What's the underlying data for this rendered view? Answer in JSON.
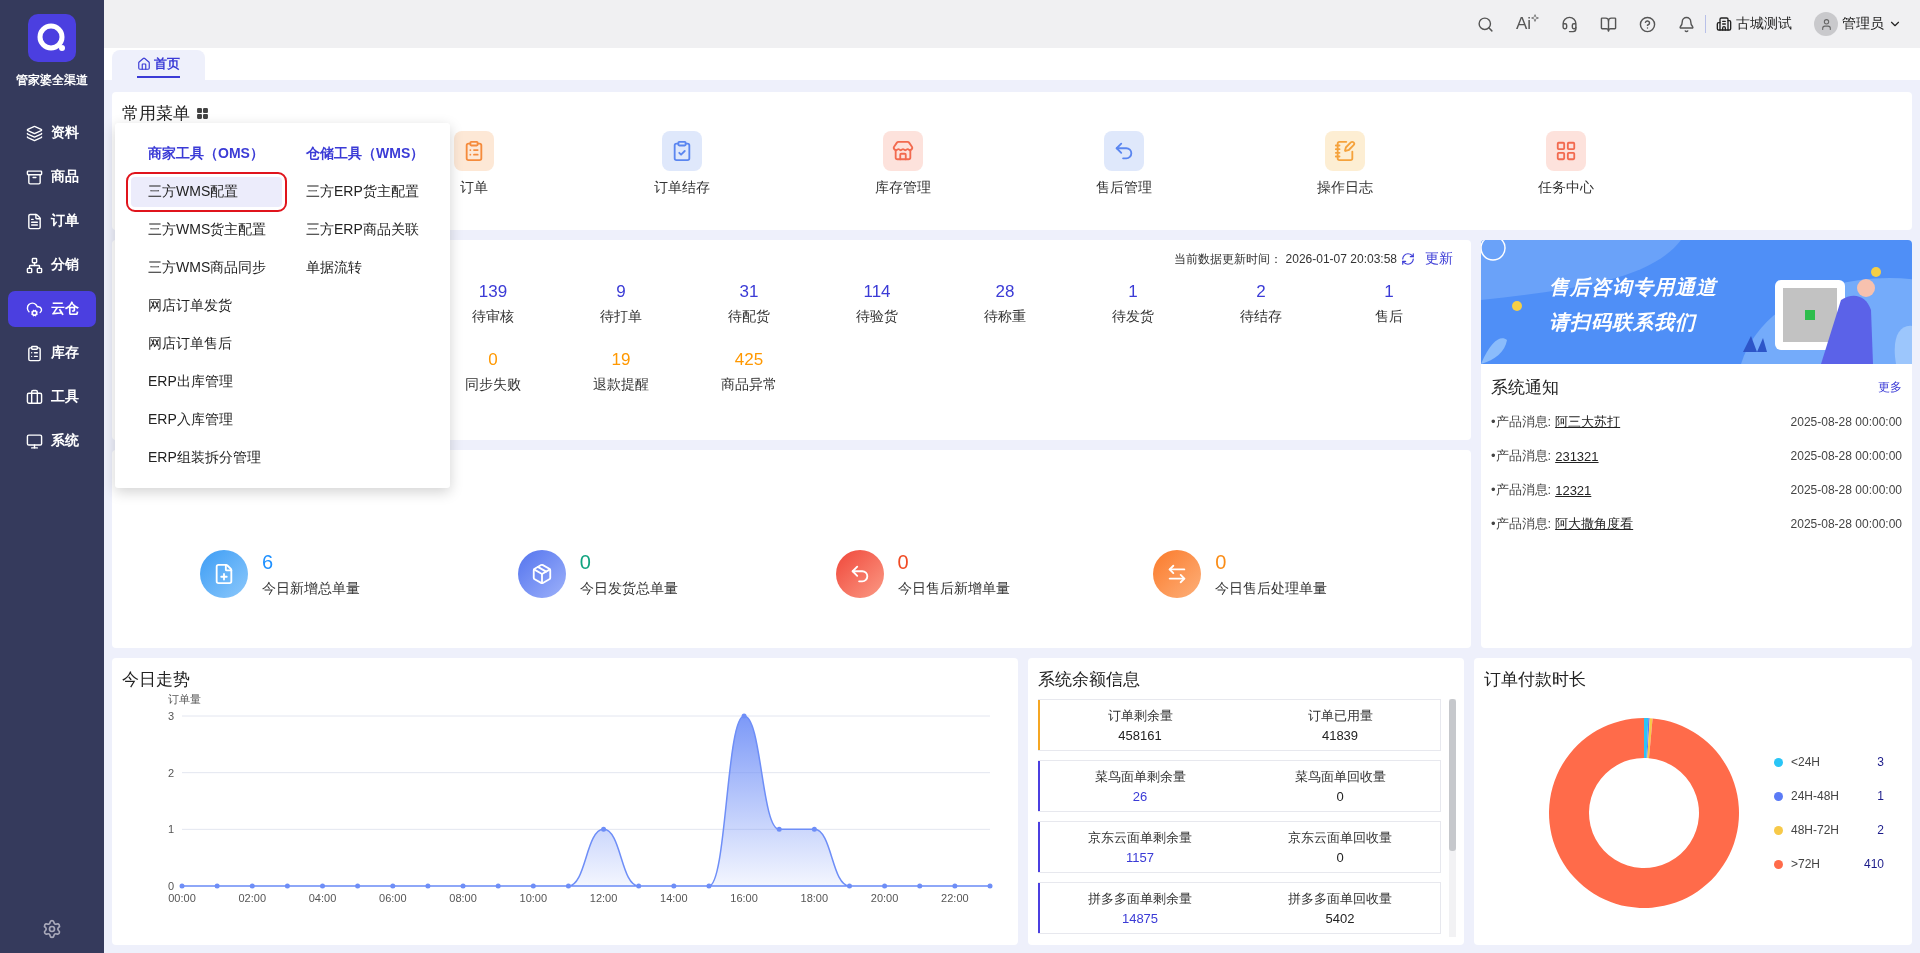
{
  "sidebar": {
    "brand": "管家婆全渠道",
    "items": [
      {
        "kind": "layers",
        "label": "资料",
        "selected": false
      },
      {
        "kind": "goods",
        "label": "商品",
        "selected": false
      },
      {
        "kind": "order",
        "label": "订单",
        "selected": false
      },
      {
        "kind": "network",
        "label": "分销",
        "selected": false
      },
      {
        "kind": "cloud",
        "label": "云仓",
        "selected": true
      },
      {
        "kind": "stock",
        "label": "库存",
        "selected": false
      },
      {
        "kind": "tools",
        "label": "工具",
        "selected": false
      },
      {
        "kind": "system",
        "label": "系统",
        "selected": false
      }
    ]
  },
  "header": {
    "ai": "Ai",
    "company": "古城测试",
    "user": "管理员"
  },
  "tabs": [
    {
      "label": "首页",
      "selected": true
    }
  ],
  "common_menu": {
    "title": "常用菜单",
    "items": [
      {
        "kind": "orange",
        "label": "订单"
      },
      {
        "kind": "blue",
        "label": "订单结存"
      },
      {
        "kind": "red",
        "label": "库存管理"
      },
      {
        "kind": "blue2",
        "label": "售后管理"
      },
      {
        "kind": "amber",
        "label": "操作日志"
      },
      {
        "kind": "grid",
        "label": "任务中心"
      }
    ]
  },
  "dropdown": {
    "columns": [
      {
        "title": "商家工具（OMS）",
        "items": [
          {
            "label": "三方WMS配置",
            "selected": true
          },
          {
            "label": "三方WMS货主配置",
            "selected": false
          },
          {
            "label": "三方WMS商品同步",
            "selected": false
          },
          {
            "label": "网店订单发货",
            "selected": false
          },
          {
            "label": "网店订单售后",
            "selected": false
          },
          {
            "label": "ERP出库管理",
            "selected": false
          },
          {
            "label": "ERP入库管理",
            "selected": false
          },
          {
            "label": "ERP组装拆分管理",
            "selected": false
          }
        ]
      },
      {
        "title": "仓储工具（WMS）",
        "items": [
          {
            "label": "三方ERP货主配置",
            "selected": false
          },
          {
            "label": "三方ERP商品关联",
            "selected": false
          },
          {
            "label": "单据流转",
            "selected": false
          }
        ]
      }
    ]
  },
  "stats": {
    "update_label": "当前数据更新时间：",
    "update_time": "2026-01-07 20:03:58",
    "refresh": "更新",
    "rows": [
      [
        {
          "value": "139",
          "label": "待审核"
        },
        {
          "value": "9",
          "label": "待打单"
        },
        {
          "value": "31",
          "label": "待配货"
        },
        {
          "value": "114",
          "label": "待验货"
        },
        {
          "value": "28",
          "label": "待称重"
        },
        {
          "value": "1",
          "label": "待发货"
        },
        {
          "value": "2",
          "label": "待结存"
        },
        {
          "value": "1",
          "label": "售后"
        }
      ],
      [
        {
          "value": "0",
          "label": "同步失败",
          "kind": "warn"
        },
        {
          "value": "19",
          "label": "退款提醒",
          "kind": "warn"
        },
        {
          "value": "425",
          "label": "商品异常",
          "kind": "warn"
        }
      ]
    ]
  },
  "today": [
    {
      "kind": "new",
      "value": "6",
      "label": "今日新增总单量",
      "color": "#1e90ff"
    },
    {
      "kind": "ship",
      "value": "0",
      "label": "今日发货总单量",
      "color": "#10a37f"
    },
    {
      "kind": "return",
      "value": "0",
      "label": "今日售后新增单量",
      "color": "#f04a23"
    },
    {
      "kind": "process",
      "value": "0",
      "label": "今日售后处理单量",
      "color": "#fa8c16"
    }
  ],
  "banner": {
    "lines": [
      "售后咨询专用通道",
      "请扫码联系我们"
    ]
  },
  "notices": {
    "title": "系统通知",
    "more": "更多",
    "items": [
      {
        "prefix": "•产品消息:",
        "link": "阿三大苏打",
        "time": "2025-08-28 00:00:00"
      },
      {
        "prefix": "•产品消息:",
        "link": "231321",
        "time": "2025-08-28 00:00:00"
      },
      {
        "prefix": "•产品消息:",
        "link": "12321",
        "time": "2025-08-28 00:00:00"
      },
      {
        "prefix": "•产品消息:",
        "link": "阿大撒角度看",
        "time": "2025-08-28 00:00:00"
      }
    ]
  },
  "trend": {
    "title": "今日走势",
    "chart_data": {
      "type": "area",
      "ylabel": "订单量",
      "x": [
        0,
        1,
        2,
        3,
        4,
        5,
        6,
        7,
        8,
        9,
        10,
        11,
        12,
        13,
        14,
        15,
        16,
        17,
        18,
        19,
        20,
        21,
        22,
        23
      ],
      "series": [
        {
          "color": "#6e8ef7",
          "values": [
            0,
            0,
            0,
            0,
            0,
            0,
            0,
            0,
            0,
            0,
            0,
            0,
            1,
            0,
            0,
            0,
            3,
            1,
            1,
            0,
            0,
            0,
            0,
            0
          ]
        }
      ],
      "xlim": [
        0,
        23
      ],
      "ylim": [
        0,
        3
      ],
      "yticks": [
        0,
        1,
        2,
        3
      ],
      "xticks": [
        {
          "value": 0,
          "label": "00:00"
        },
        {
          "value": 2,
          "label": "02:00"
        },
        {
          "value": 4,
          "label": "04:00"
        },
        {
          "value": 6,
          "label": "06:00"
        },
        {
          "value": 8,
          "label": "08:00"
        },
        {
          "value": 10,
          "label": "10:00"
        },
        {
          "value": 12,
          "label": "12:00"
        },
        {
          "value": 14,
          "label": "14:00"
        },
        {
          "value": 16,
          "label": "16:00"
        },
        {
          "value": 18,
          "label": "18:00"
        },
        {
          "value": 20,
          "label": "20:00"
        },
        {
          "value": 22,
          "label": "22:00"
        }
      ]
    }
  },
  "balance": {
    "title": "系统余额信息",
    "rows": [
      {
        "kind": "order",
        "color": "#f5a623",
        "left_label": "订单剩余量",
        "left_value": "458161",
        "right_label": "订单已用量",
        "right_value": "41839"
      },
      {
        "kind": "waybill",
        "color": "#4b3fe0",
        "left_label": "菜鸟面单剩余量",
        "left_value": "26",
        "right_label": "菜鸟面单回收量",
        "right_value": "0"
      },
      {
        "kind": "waybill",
        "color": "#4b3fe0",
        "left_label": "京东云面单剩余量",
        "left_value": "1157",
        "right_label": "京东云面单回收量",
        "right_value": "0"
      },
      {
        "kind": "waybill",
        "color": "#4b3fe0",
        "left_label": "拼多多面单剩余量",
        "left_value": "14875",
        "right_label": "拼多多面单回收量",
        "right_value": "5402"
      }
    ]
  },
  "payment": {
    "title": "订单付款时长",
    "chart_data": {
      "type": "donut",
      "categories": [
        "<24H",
        "24H-48H",
        "48H-72H",
        ">72H"
      ],
      "colors": [
        "#29c5f6",
        "#5b7bf6",
        "#f7c948",
        "#ff6b4a"
      ],
      "series": [
        {
          "values": [
            0.72,
            0.24,
            0.48,
            98.56
          ]
        }
      ]
    },
    "legend": [
      {
        "value": "3"
      },
      {
        "value": "1"
      },
      {
        "value": "2"
      },
      {
        "value": "410"
      }
    ]
  }
}
